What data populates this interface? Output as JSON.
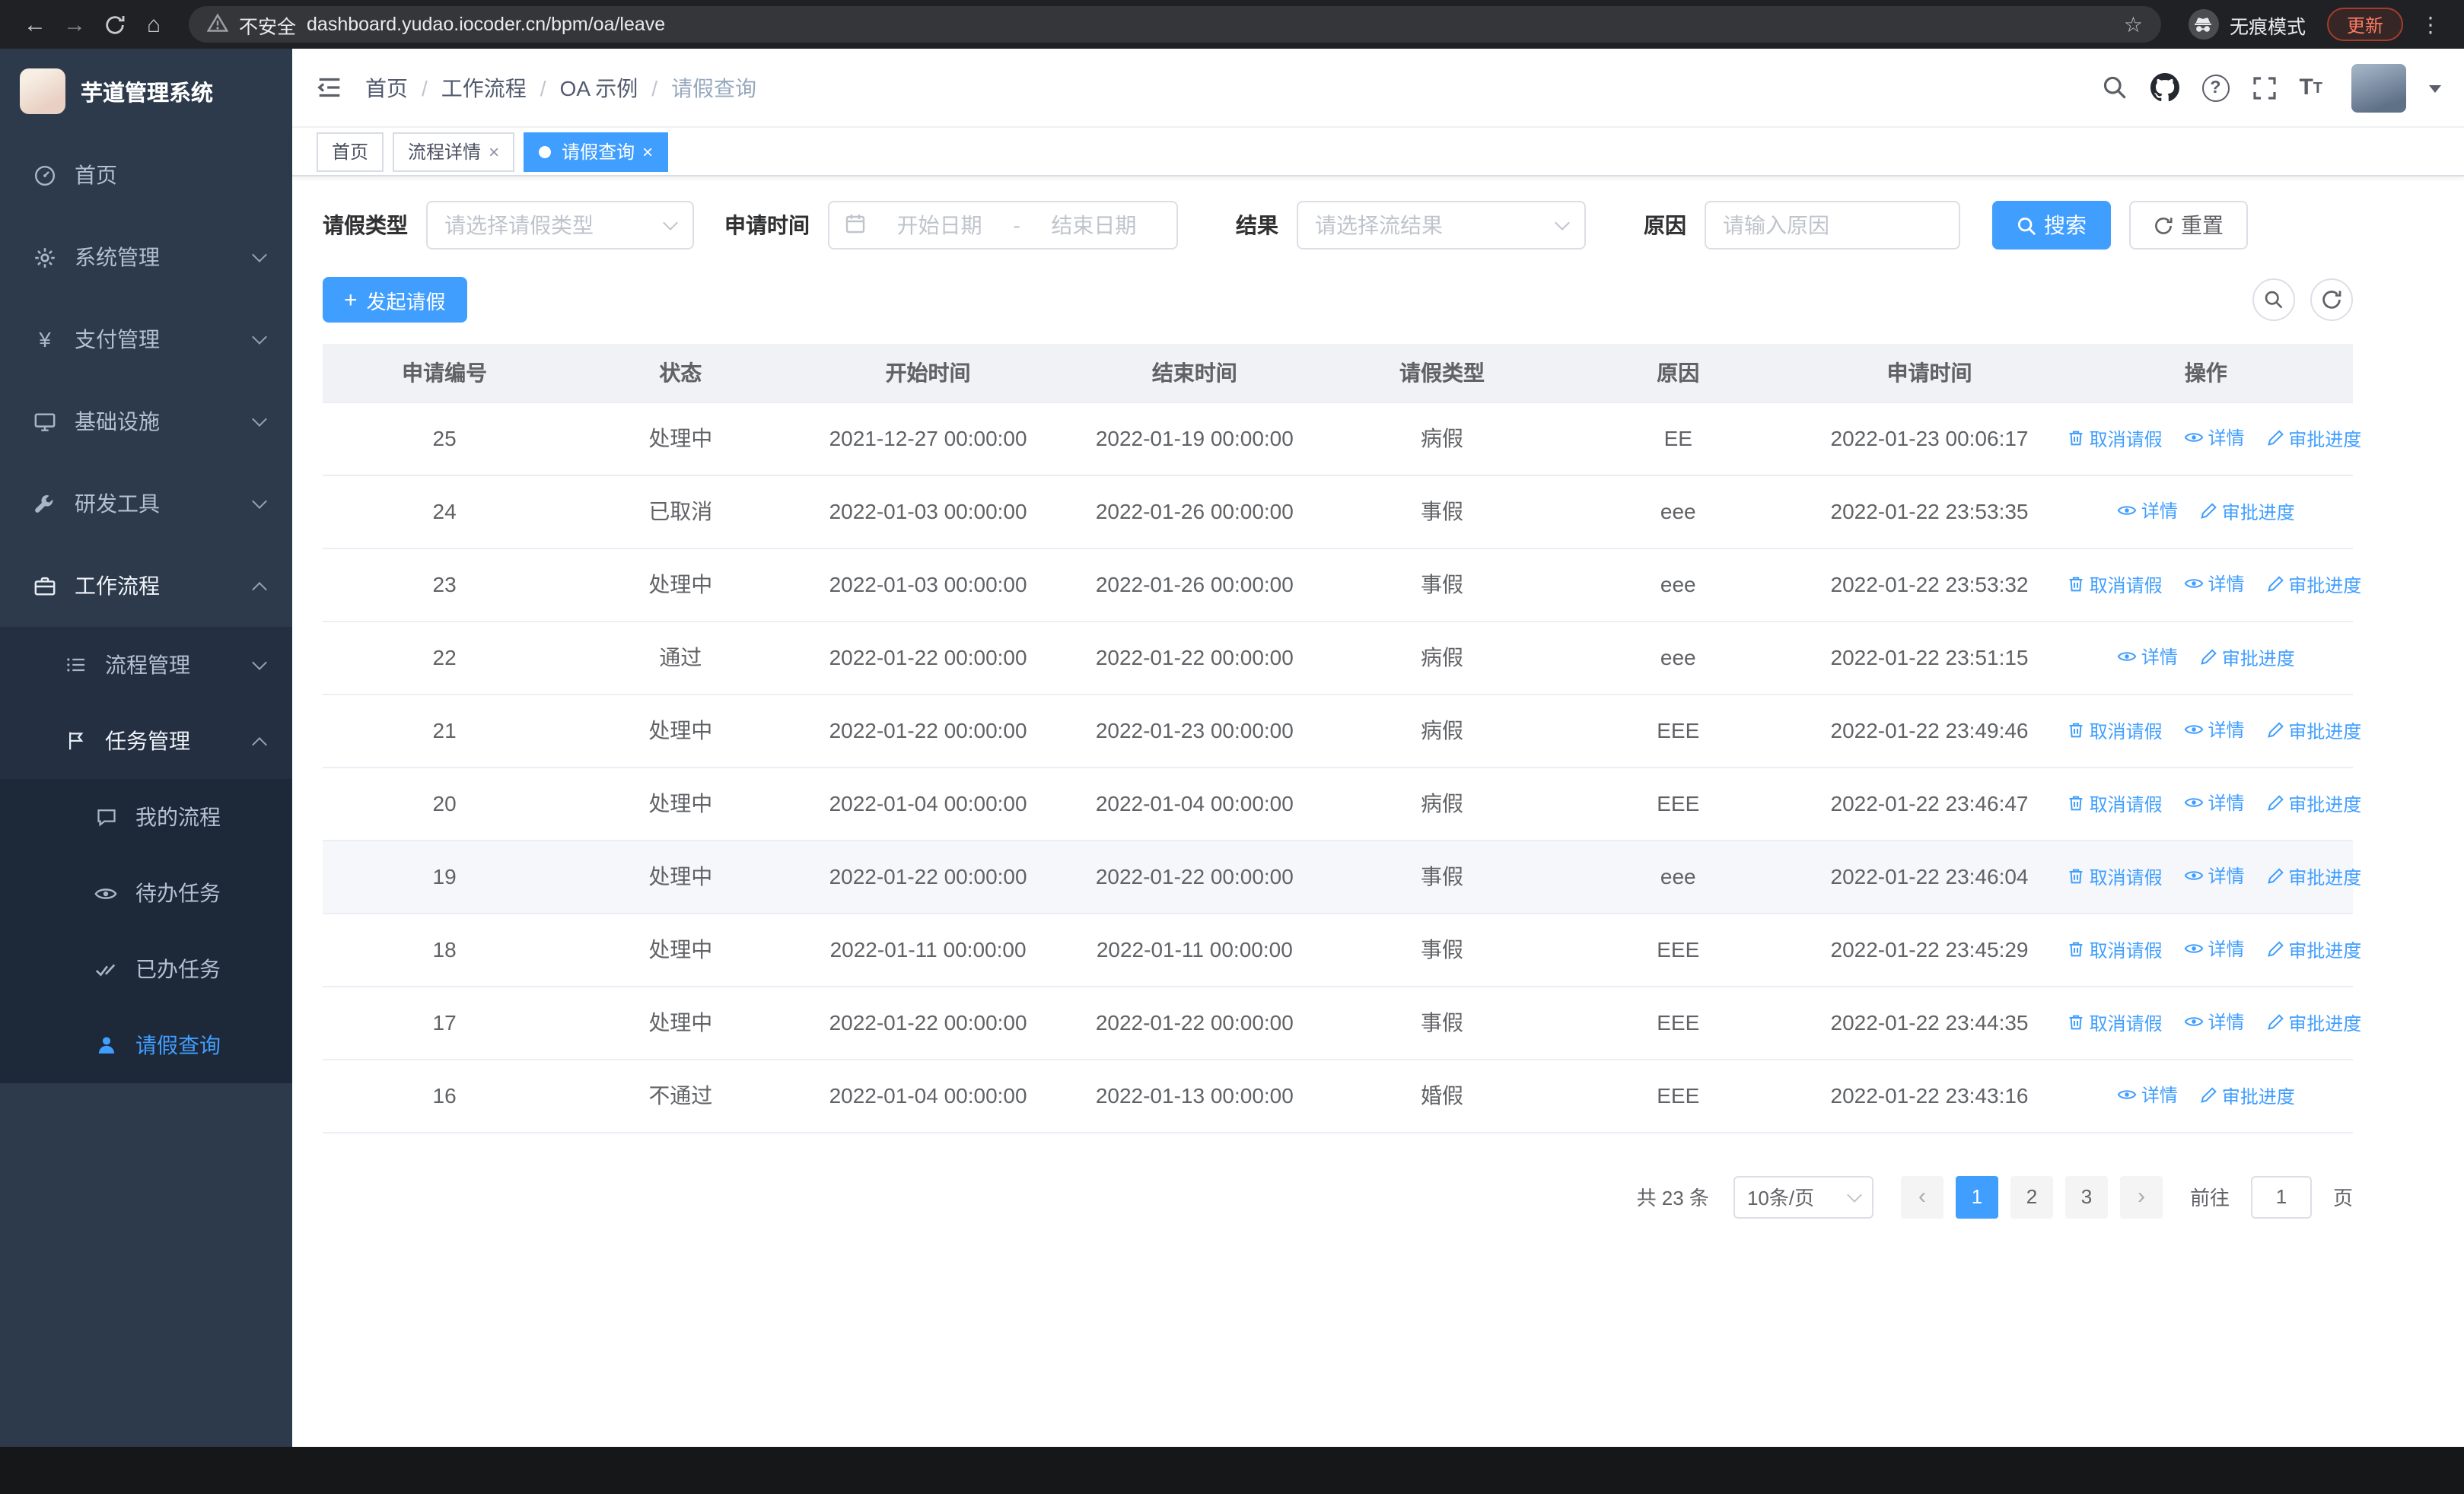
{
  "browser": {
    "back_icon": "←",
    "forward_icon": "→",
    "home_icon": "⌂",
    "security_label": "不安全",
    "url": "dashboard.yudao.iocoder.cn/bpm/oa/leave",
    "star_icon": "☆",
    "incognito_label": "无痕模式",
    "update_label": "更新",
    "menu_icon": "⋮"
  },
  "colors": {
    "accent": "#409eff",
    "sidebar_bg": "#2d3a4b",
    "table_header_bg": "#f0f2f5",
    "link": "#409eff"
  },
  "sidebar": {
    "logo_title": "芋道管理系统",
    "items": [
      {
        "label": "首页"
      },
      {
        "label": "系统管理"
      },
      {
        "label": "支付管理"
      },
      {
        "label": "基础设施"
      },
      {
        "label": "研发工具"
      },
      {
        "label": "工作流程"
      }
    ],
    "workflow_children": [
      {
        "label": "流程管理"
      },
      {
        "label": "任务管理"
      }
    ],
    "task_children": [
      {
        "label": "我的流程"
      },
      {
        "label": "待办任务"
      },
      {
        "label": "已办任务"
      },
      {
        "label": "请假查询"
      }
    ]
  },
  "header": {
    "breadcrumb": [
      "首页",
      "工作流程",
      "OA 示例",
      "请假查询"
    ],
    "help_icon": "?"
  },
  "icons": {
    "close": "×",
    "plus": "+",
    "yen": "¥",
    "prev": "‹",
    "next": "›",
    "font_large": "T",
    "font_small": "T"
  },
  "tabs": [
    {
      "label": "首页"
    },
    {
      "label": "流程详情"
    },
    {
      "label": "请假查询"
    }
  ],
  "filters": {
    "leave_type": {
      "label": "请假类型",
      "placeholder": "请选择请假类型"
    },
    "apply_time": {
      "label": "申请时间",
      "start_placeholder": "开始日期",
      "separator": "-",
      "end_placeholder": "结束日期"
    },
    "result": {
      "label": "结果",
      "placeholder": "请选择流结果"
    },
    "reason": {
      "label": "原因",
      "placeholder": "请输入原因"
    },
    "search_label": "搜索",
    "reset_label": "重置"
  },
  "toolbar": {
    "create_label": "发起请假"
  },
  "table": {
    "columns": [
      "申请编号",
      "状态",
      "开始时间",
      "结束时间",
      "请假类型",
      "原因",
      "申请时间",
      "操作"
    ],
    "actions": {
      "cancel": "取消请假",
      "detail": "详情",
      "progress": "审批进度"
    },
    "rows": [
      {
        "id": "25",
        "status": "处理中",
        "start": "2021-12-27 00:00:00",
        "end": "2022-01-19 00:00:00",
        "type": "病假",
        "reason": "EE",
        "apply_time": "2022-01-23 00:06:17",
        "cancellable": true,
        "row_class": ""
      },
      {
        "id": "24",
        "status": "已取消",
        "start": "2022-01-03 00:00:00",
        "end": "2022-01-26 00:00:00",
        "type": "事假",
        "reason": "eee",
        "apply_time": "2022-01-22 23:53:35",
        "cancellable": false,
        "row_class": ""
      },
      {
        "id": "23",
        "status": "处理中",
        "start": "2022-01-03 00:00:00",
        "end": "2022-01-26 00:00:00",
        "type": "事假",
        "reason": "eee",
        "apply_time": "2022-01-22 23:53:32",
        "cancellable": true,
        "row_class": ""
      },
      {
        "id": "22",
        "status": "通过",
        "start": "2022-01-22 00:00:00",
        "end": "2022-01-22 00:00:00",
        "type": "病假",
        "reason": "eee",
        "apply_time": "2022-01-22 23:51:15",
        "cancellable": false,
        "row_class": ""
      },
      {
        "id": "21",
        "status": "处理中",
        "start": "2022-01-22 00:00:00",
        "end": "2022-01-23 00:00:00",
        "type": "病假",
        "reason": "EEE",
        "apply_time": "2022-01-22 23:49:46",
        "cancellable": true,
        "row_class": ""
      },
      {
        "id": "20",
        "status": "处理中",
        "start": "2022-01-04 00:00:00",
        "end": "2022-01-04 00:00:00",
        "type": "病假",
        "reason": "EEE",
        "apply_time": "2022-01-22 23:46:47",
        "cancellable": true,
        "row_class": ""
      },
      {
        "id": "19",
        "status": "处理中",
        "start": "2022-01-22 00:00:00",
        "end": "2022-01-22 00:00:00",
        "type": "事假",
        "reason": "eee",
        "apply_time": "2022-01-22 23:46:04",
        "cancellable": true,
        "row_class": "row-hover"
      },
      {
        "id": "18",
        "status": "处理中",
        "start": "2022-01-11 00:00:00",
        "end": "2022-01-11 00:00:00",
        "type": "事假",
        "reason": "EEE",
        "apply_time": "2022-01-22 23:45:29",
        "cancellable": true,
        "row_class": ""
      },
      {
        "id": "17",
        "status": "处理中",
        "start": "2022-01-22 00:00:00",
        "end": "2022-01-22 00:00:00",
        "type": "事假",
        "reason": "EEE",
        "apply_time": "2022-01-22 23:44:35",
        "cancellable": true,
        "row_class": ""
      },
      {
        "id": "16",
        "status": "不通过",
        "start": "2022-01-04 00:00:00",
        "end": "2022-01-13 00:00:00",
        "type": "婚假",
        "reason": "EEE",
        "apply_time": "2022-01-22 23:43:16",
        "cancellable": false,
        "row_class": ""
      }
    ]
  },
  "pagination": {
    "total_label": "共 23 条",
    "page_size_label": "10条/页",
    "pages": [
      "1",
      "2",
      "3"
    ],
    "active_page": "1",
    "goto_label": "前往",
    "goto_value": "1",
    "unit_label": "页"
  }
}
